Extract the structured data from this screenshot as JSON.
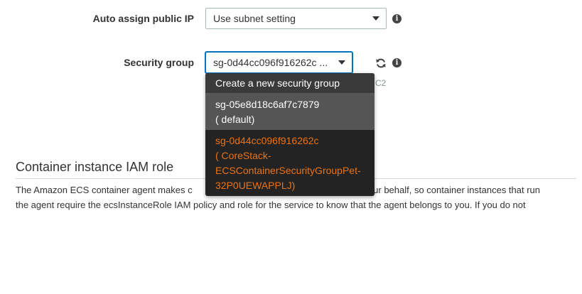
{
  "form": {
    "auto_assign": {
      "label": "Auto assign public IP",
      "value": "Use subnet setting"
    },
    "security_group": {
      "label": "Security group",
      "value": "sg-0d44cc096f916262c ...",
      "hint": "C2"
    }
  },
  "dropdown": {
    "create_label": "Create a new security group",
    "options": [
      {
        "lines": [
          "sg-05e8d18c6af7c7879",
          "( default)"
        ],
        "state": "hover"
      },
      {
        "lines": [
          "sg-0d44cc096f916262c",
          "( CoreStack-",
          "ECSContainerSecurityGroupPet-",
          "32P0UEWAPPLJ)"
        ],
        "state": "selected"
      }
    ]
  },
  "section": {
    "title": "Container instance IAM role",
    "paragraph_lines": [
      "The Amazon ECS container agent makes c",
      "n your behalf, so container instances that run",
      "the agent require the ecsInstanceRole IAM policy and role for the service to know that the agent belongs to you. If you do not"
    ]
  },
  "icons": {
    "info": "info-icon",
    "refresh": "refresh-icon",
    "caret": "caret-down-icon"
  },
  "colors": {
    "selected_option": "#ec7211",
    "dropdown_bg": "#232323",
    "focus_border": "#0073bb"
  }
}
